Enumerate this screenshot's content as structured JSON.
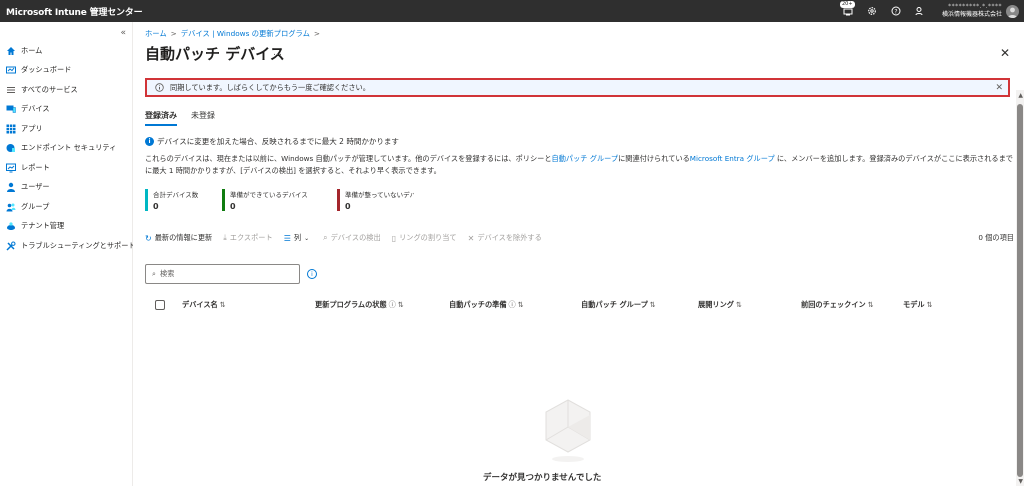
{
  "app": {
    "title": "Microsoft Intune 管理センター"
  },
  "topbar": {
    "badge": "20+",
    "user_name": "*********.*.****",
    "user_org": "横浜情報機器株式会社"
  },
  "sidebar": {
    "collapse": "«",
    "items": [
      {
        "label": "ホーム",
        "icon": "home-icon"
      },
      {
        "label": "ダッシュボード",
        "icon": "dashboard-icon"
      },
      {
        "label": "すべてのサービス",
        "icon": "list-icon"
      },
      {
        "label": "デバイス",
        "icon": "devices-icon"
      },
      {
        "label": "アプリ",
        "icon": "apps-icon"
      },
      {
        "label": "エンドポイント セキュリティ",
        "icon": "shield-icon"
      },
      {
        "label": "レポート",
        "icon": "reports-icon"
      },
      {
        "label": "ユーザー",
        "icon": "user-icon"
      },
      {
        "label": "グループ",
        "icon": "group-icon"
      },
      {
        "label": "テナント管理",
        "icon": "tenant-icon"
      },
      {
        "label": "トラブルシューティングとサポート",
        "icon": "wrench-icon"
      }
    ]
  },
  "breadcrumb": [
    "ホーム",
    "デバイス | Windows の更新プログラム"
  ],
  "page": {
    "title": "自動パッチ デバイス",
    "more": "…",
    "close": "✕"
  },
  "banner": {
    "text": "同期しています。しばらくしてからもう一度ご確認ください。",
    "close": "✕"
  },
  "tabs": [
    "登録済み",
    "未登録"
  ],
  "notice": {
    "text": "デバイスに変更を加えた場合、反映されるまでに最大 2 時間かかります"
  },
  "description": {
    "part1": "これらのデバイスは、現在または以前に、Windows 自動パッチが管理しています。他のデバイスを登録するには、ポリシーと",
    "link1": "自動パッチ グループ",
    "part2": "に関連付けられている",
    "link2": "Microsoft Entra グループ",
    "part3": " に、メンバーを追加します。登録済みのデバイスがここに表示されるまでに最大 1 時間かかりますが、[デバイスの検出] を選択すると、それより早く表示できます。"
  },
  "stats": [
    {
      "label": "合計デバイス数",
      "value": "0",
      "color": "#00b7c3"
    },
    {
      "label": "準備ができているデバイス",
      "value": "0",
      "color": "#107c10"
    },
    {
      "label": "準備が整っていないデバ...",
      "value": "0",
      "color": "#a4262c"
    }
  ],
  "toolbar": {
    "refresh": "最新の情報に更新",
    "export": "エクスポート",
    "columns": "列",
    "discover": "デバイスの検出",
    "assign_ring": "リングの割り当て",
    "exclude": "デバイスを除外する",
    "count": "0 個の項目"
  },
  "search": {
    "placeholder": "検索"
  },
  "table": {
    "columns": [
      "デバイス名",
      "更新プログラムの状態",
      "自動パッチの準備",
      "自動パッチ グループ",
      "展開リング",
      "前回のチェックイン",
      "モデル"
    ]
  },
  "empty": {
    "text": "データが見つかりませんでした"
  }
}
